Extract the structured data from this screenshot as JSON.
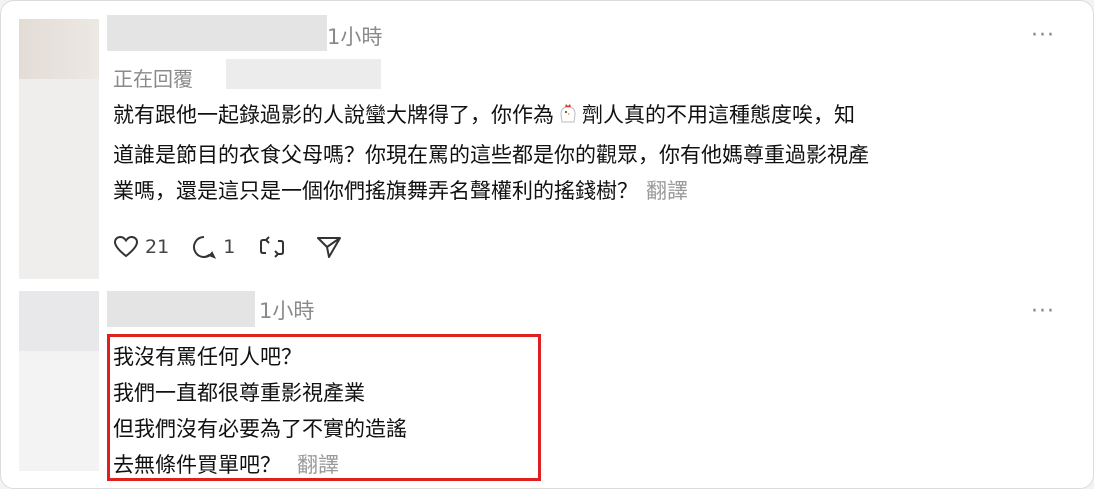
{
  "comment1": {
    "time": "1小時",
    "replying_label": "正在回覆",
    "text_lines": [
      "就有跟他一起錄過影的人說蠻大牌得了，你作為",
      "劑人真的不用這種態度唉，知",
      "道誰是節目的衣食父母嗎？你現在罵的這些都是你的觀眾，你有他媽尊重過影視產",
      "業嗎，還是這只是一個你們搖旗舞弄名聲權利的搖錢樹？"
    ],
    "translate_label": "翻譯",
    "likes": "21",
    "replies": "1",
    "more_label": "···"
  },
  "comment2": {
    "time": "1小時",
    "lines": [
      "我沒有罵任何人吧？",
      "我們一直都很尊重影視產業",
      "但我們沒有必要為了不實的造謠",
      "去無條件買單吧？"
    ],
    "translate_label": "翻譯",
    "more_label": "···"
  },
  "colors": {
    "highlight": "#e02020",
    "text": "#111111",
    "muted": "#8a8a8a"
  }
}
